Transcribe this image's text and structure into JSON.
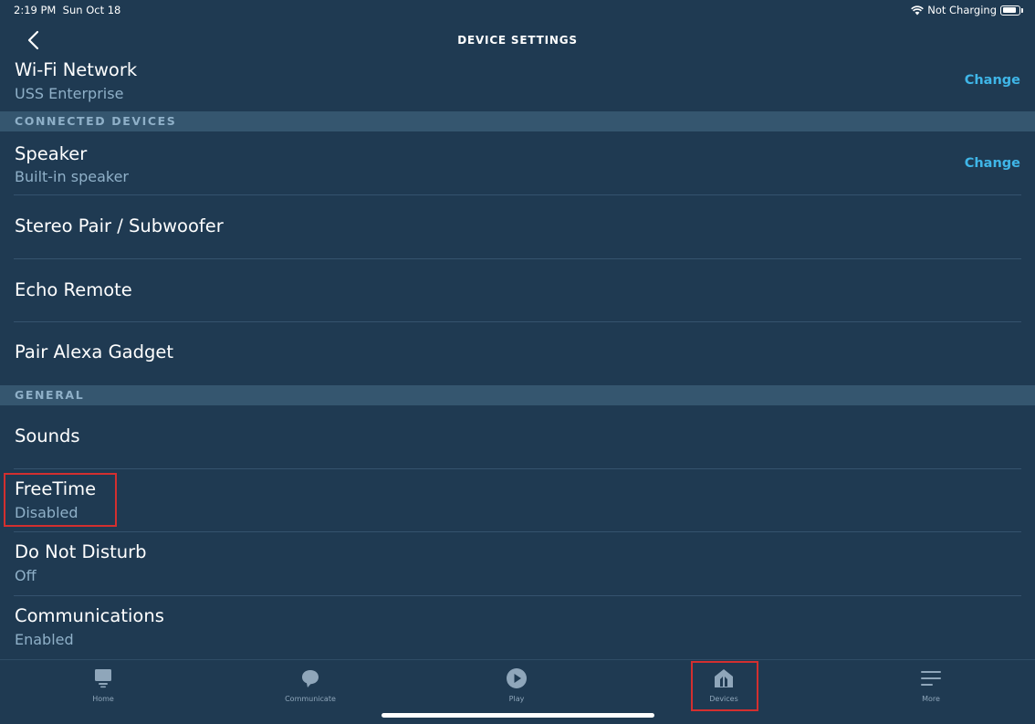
{
  "status_bar": {
    "time": "2:19 PM",
    "date": "Sun Oct 18",
    "charging": "Not Charging",
    "battery_level": 0.85
  },
  "header": {
    "title": "DEVICE SETTINGS"
  },
  "wifi": {
    "title": "Wi-Fi Network",
    "value": "USS Enterprise",
    "action": "Change"
  },
  "sections": {
    "connected": "CONNECTED DEVICES",
    "general": "GENERAL"
  },
  "connected_devices": {
    "speaker": {
      "title": "Speaker",
      "value": "Built-in speaker",
      "action": "Change"
    },
    "stereo": {
      "title": "Stereo Pair / Subwoofer"
    },
    "remote": {
      "title": "Echo Remote"
    },
    "gadget": {
      "title": "Pair Alexa Gadget"
    }
  },
  "general": {
    "sounds": {
      "title": "Sounds"
    },
    "freetime": {
      "title": "FreeTime",
      "value": "Disabled"
    },
    "dnd": {
      "title": "Do Not Disturb",
      "value": "Off"
    },
    "communications": {
      "title": "Communications",
      "value": "Enabled"
    }
  },
  "tabs": [
    {
      "label": "Home",
      "icon": "home-icon"
    },
    {
      "label": "Communicate",
      "icon": "chat-bubble-icon"
    },
    {
      "label": "Play",
      "icon": "play-icon"
    },
    {
      "label": "Devices",
      "icon": "devices-icon"
    },
    {
      "label": "More",
      "icon": "menu-icon"
    }
  ],
  "colors": {
    "background": "#1f3a52",
    "section_header": "#35566f",
    "accent_link": "#3fb6e8",
    "highlight": "#d32f2f"
  }
}
